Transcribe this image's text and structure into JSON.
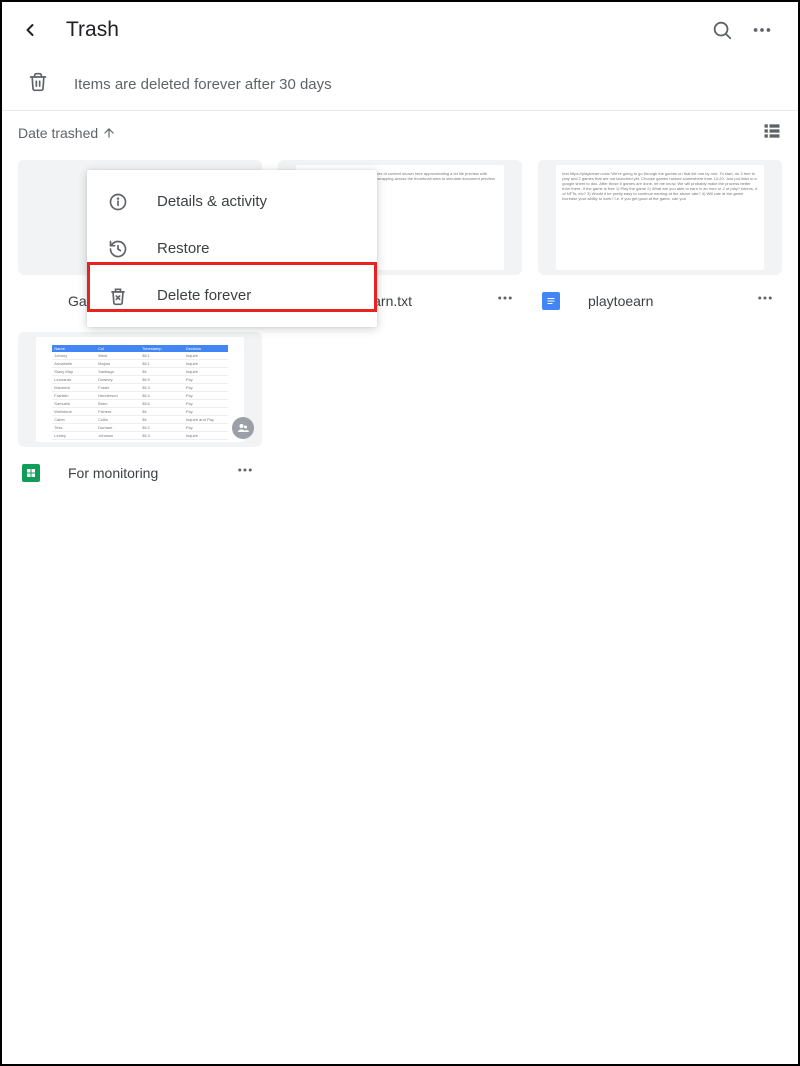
{
  "header": {
    "title": "Trash"
  },
  "infoBar": {
    "text": "Items are deleted forever after 30 days"
  },
  "sort": {
    "label": "Date trashed"
  },
  "contextMenu": {
    "details": "Details & activity",
    "restore": "Restore",
    "deleteForever": "Delete forever"
  },
  "files": [
    {
      "name": "Games",
      "type": "folder"
    },
    {
      "name": "playtoearn.txt",
      "type": "doc"
    },
    {
      "name": "playtoearn",
      "type": "doc"
    },
    {
      "name": "For monitoring",
      "type": "sheet"
    }
  ]
}
